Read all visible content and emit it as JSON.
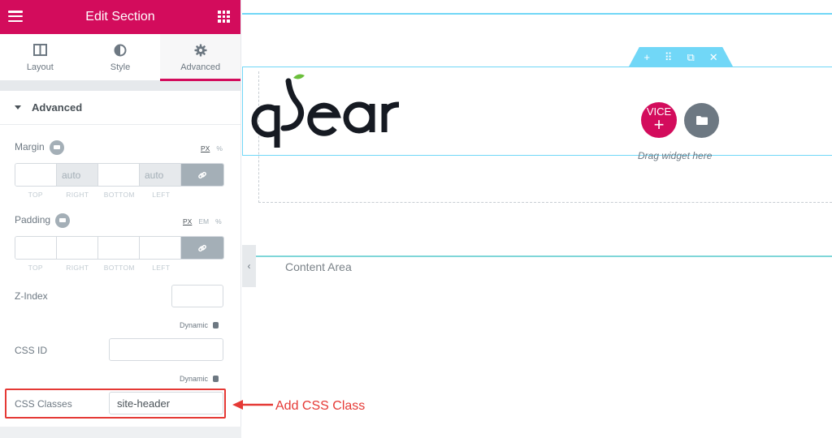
{
  "panel": {
    "title": "Edit Section",
    "header_color": "#d30c5c",
    "tabs": [
      {
        "label": "Layout",
        "icon": "columns-icon",
        "active": false
      },
      {
        "label": "Style",
        "icon": "half-circle-icon",
        "active": false
      },
      {
        "label": "Advanced",
        "icon": "gear-icon",
        "active": true
      }
    ],
    "section_title": "Advanced",
    "margin": {
      "label": "Margin",
      "units": [
        "PX",
        "%"
      ],
      "selected_unit": "PX",
      "values": {
        "top": "",
        "right": "auto",
        "bottom": "",
        "left": "auto"
      },
      "labels": [
        "TOP",
        "RIGHT",
        "BOTTOM",
        "LEFT"
      ]
    },
    "padding": {
      "label": "Padding",
      "units": [
        "PX",
        "EM",
        "%"
      ],
      "selected_unit": "PX",
      "values": {
        "top": "",
        "right": "",
        "bottom": "",
        "left": ""
      },
      "labels": [
        "TOP",
        "RIGHT",
        "BOTTOM",
        "LEFT"
      ]
    },
    "z_index": {
      "label": "Z-Index",
      "value": ""
    },
    "dynamic_label": "Dynamic",
    "css_id": {
      "label": "CSS ID",
      "value": ""
    },
    "css_classes": {
      "label": "CSS Classes",
      "value": "site-header"
    }
  },
  "canvas": {
    "logo_text": "apear",
    "overlay_text": "VICE",
    "add_symbol": "+",
    "drag_text": "Drag widget here",
    "content_area_label": "Content Area",
    "section_handle": {
      "add": "+",
      "move": "⠿",
      "duplicate": "⧉",
      "delete": "✕"
    },
    "collapse_symbol": "‹"
  },
  "annotation": {
    "text": "Add CSS Class",
    "color": "#e53935"
  }
}
